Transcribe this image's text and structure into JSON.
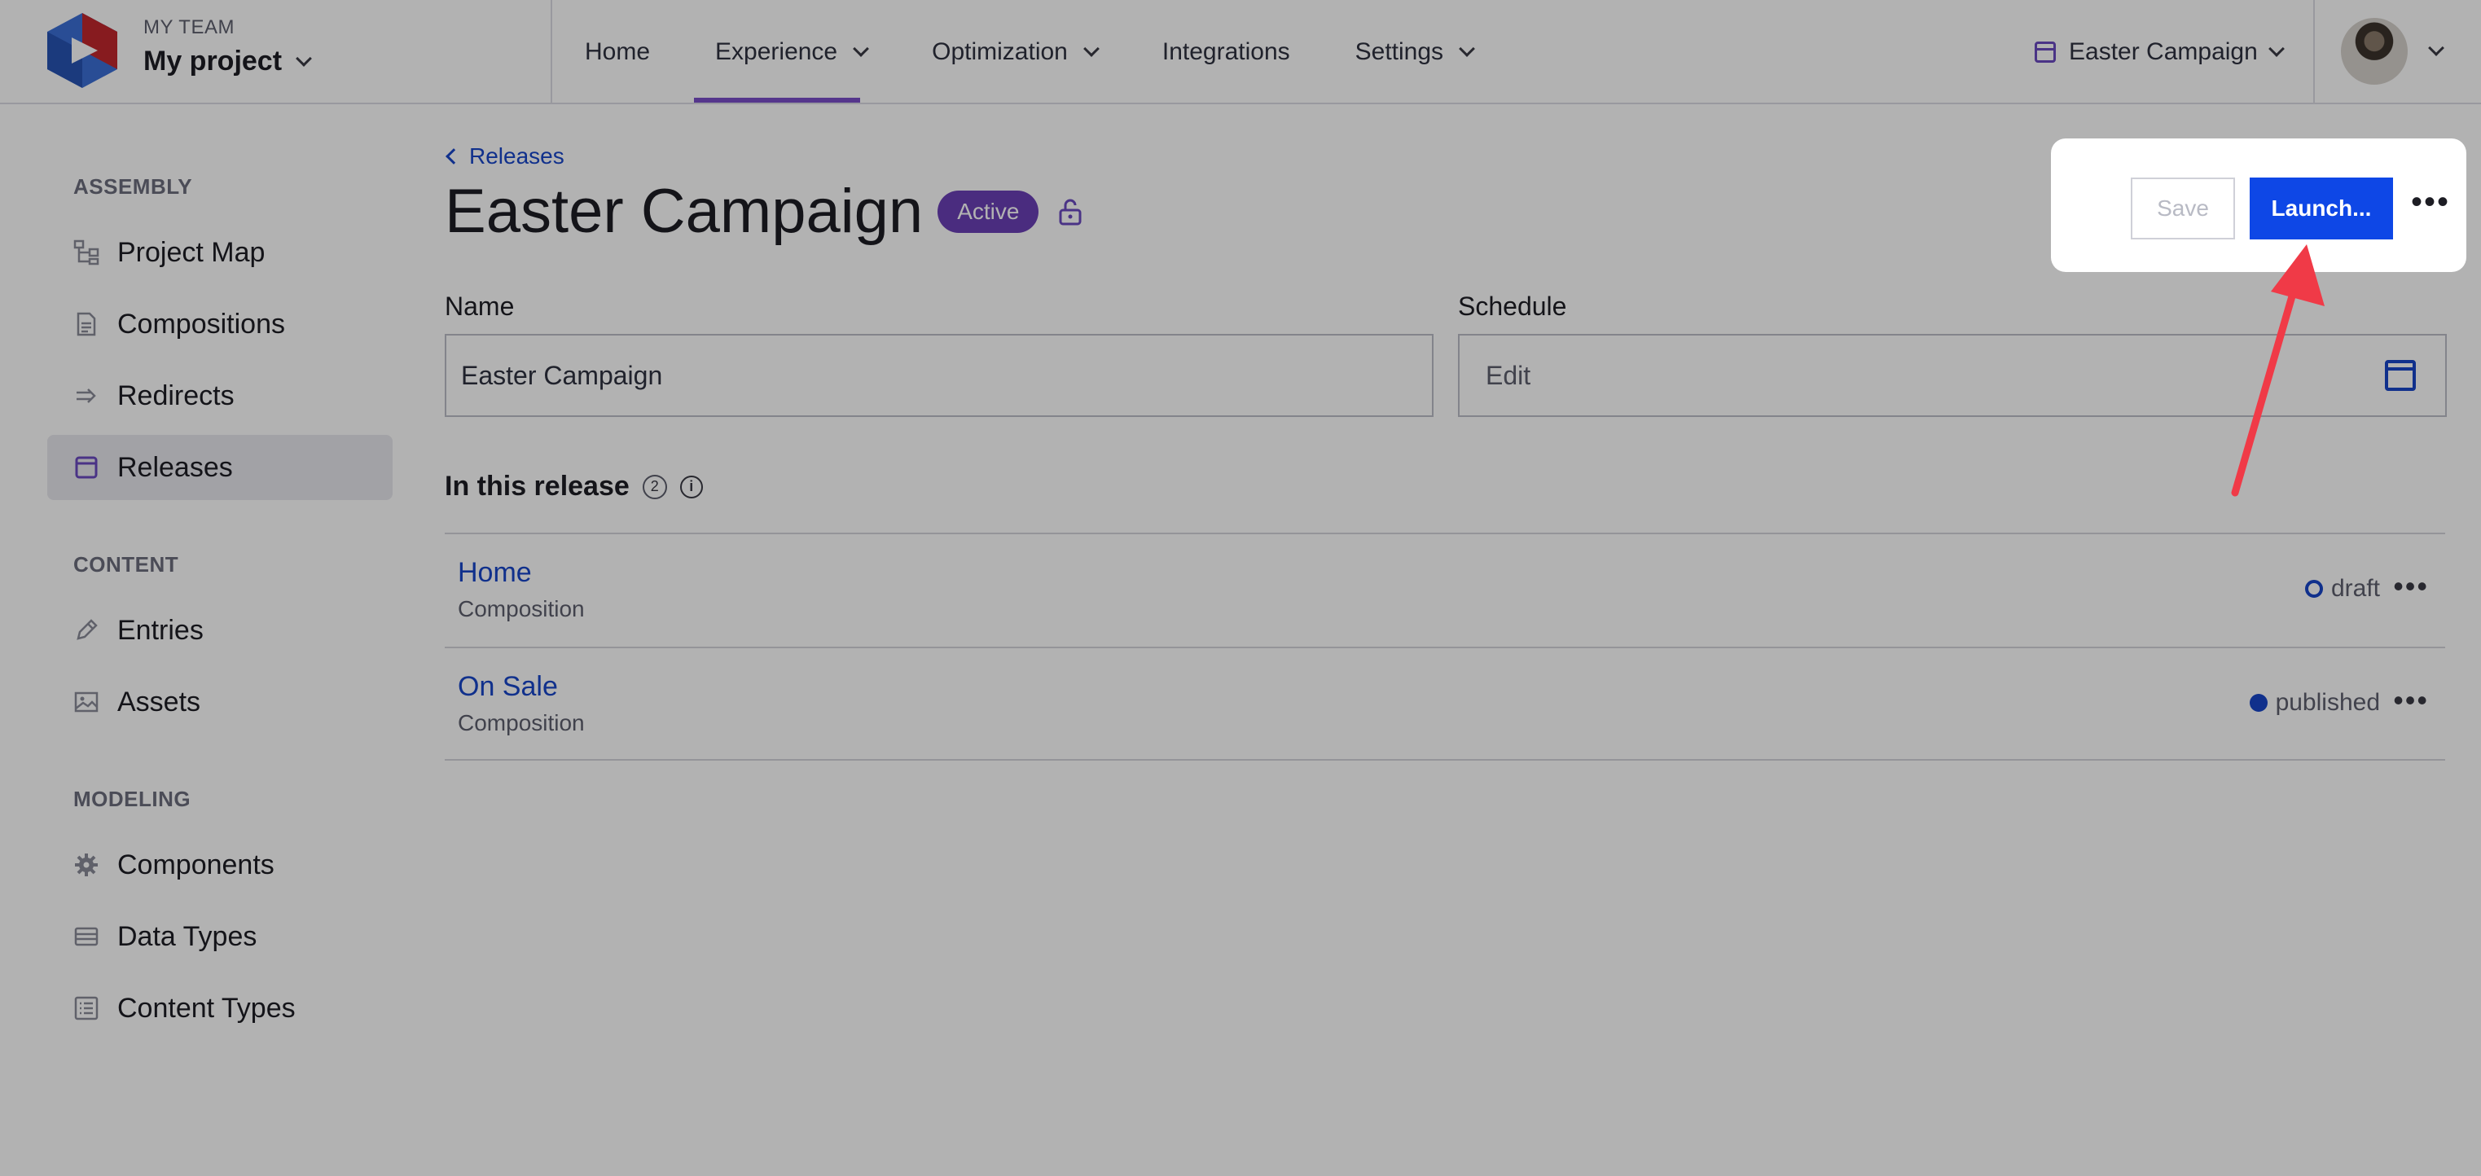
{
  "header": {
    "team_label": "MY TEAM",
    "project_name": "My project",
    "nav": [
      {
        "label": "Home",
        "dropdown": false
      },
      {
        "label": "Experience",
        "dropdown": true,
        "active": true
      },
      {
        "label": "Optimization",
        "dropdown": true
      },
      {
        "label": "Integrations",
        "dropdown": false
      },
      {
        "label": "Settings",
        "dropdown": true
      }
    ],
    "release_picker": "Easter Campaign"
  },
  "sidebar": {
    "sections": [
      {
        "title": "ASSEMBLY",
        "items": [
          {
            "label": "Project Map",
            "icon": "project-map-icon"
          },
          {
            "label": "Compositions",
            "icon": "document-icon"
          },
          {
            "label": "Redirects",
            "icon": "redirect-icon"
          },
          {
            "label": "Releases",
            "icon": "calendar-icon",
            "selected": true
          }
        ]
      },
      {
        "title": "CONTENT",
        "items": [
          {
            "label": "Entries",
            "icon": "pencil-icon"
          },
          {
            "label": "Assets",
            "icon": "image-icon"
          }
        ]
      },
      {
        "title": "MODELING",
        "items": [
          {
            "label": "Components",
            "icon": "gear-icon"
          },
          {
            "label": "Data Types",
            "icon": "data-types-icon"
          },
          {
            "label": "Content Types",
            "icon": "list-icon"
          }
        ]
      }
    ]
  },
  "main": {
    "back_link": "Releases",
    "title": "Easter Campaign",
    "status_badge": "Active",
    "name_label": "Name",
    "name_value": "Easter Campaign",
    "schedule_label": "Schedule",
    "schedule_value": "Edit",
    "section_title": "In this release",
    "section_count": "2",
    "items": [
      {
        "title": "Home",
        "type": "Composition",
        "status": "draft"
      },
      {
        "title": "On Sale",
        "type": "Composition",
        "status": "published"
      }
    ]
  },
  "actions": {
    "save_label": "Save",
    "launch_label": "Launch...",
    "more_label": "•••"
  },
  "colors": {
    "accent": "#0e47e6",
    "badge": "#6b3fb6",
    "annotation_arrow": "#f03a47"
  }
}
